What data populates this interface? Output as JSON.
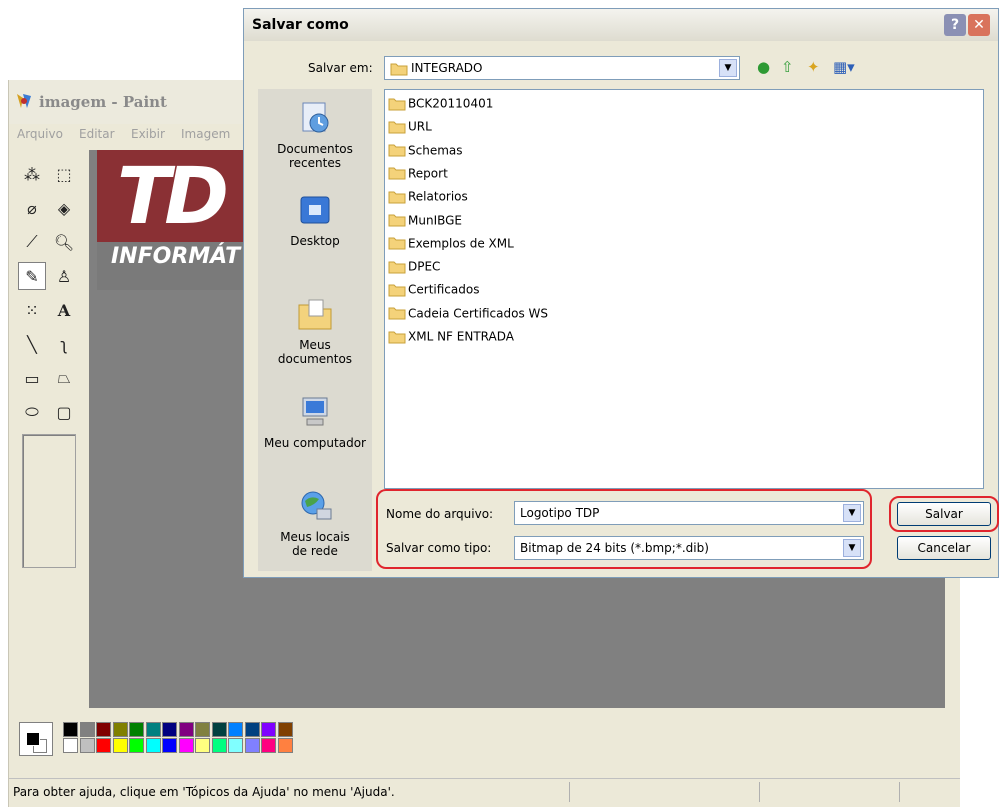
{
  "paint": {
    "title": "imagem - Paint",
    "menu": [
      "Arquivo",
      "Editar",
      "Exibir",
      "Imagem"
    ],
    "status_text": "Para obter ajuda, clique em 'Tópicos da Ajuda' no menu 'Ajuda'.",
    "logo_letters": "TD",
    "logo_sub": "INFORMÁT",
    "palette_top": [
      "#000000",
      "#808080",
      "#800000",
      "#808000",
      "#008000",
      "#008080",
      "#000080",
      "#800080",
      "#808040",
      "#004040",
      "#0080ff",
      "#004080",
      "#8000ff",
      "#804000"
    ],
    "palette_bottom": [
      "#ffffff",
      "#c0c0c0",
      "#ff0000",
      "#ffff00",
      "#00ff00",
      "#00ffff",
      "#0000ff",
      "#ff00ff",
      "#ffff80",
      "#00ff80",
      "#80ffff",
      "#8080ff",
      "#ff0080",
      "#ff8040"
    ]
  },
  "dialog": {
    "title": "Salvar como",
    "help_glyph": "?",
    "close_glyph": "✕",
    "save_in_label": "Salvar em:",
    "save_in_value": "INTEGRADO",
    "places": {
      "recent": "Documentos recentes",
      "desktop": "Desktop",
      "documents": "Meus documentos",
      "computer": "Meu computador",
      "network": "Meus locais de rede"
    },
    "folders": [
      "BCK20110401",
      "URL",
      "Schemas",
      "Report",
      "Relatorios",
      "MunIBGE",
      "Exemplos de XML",
      "DPEC",
      "Certificados",
      "Cadeia Certificados WS",
      "XML NF ENTRADA"
    ],
    "filename_label": "Nome do arquivo:",
    "filename_value": "Logotipo TDP",
    "filetype_label": "Salvar como tipo:",
    "filetype_value": "Bitmap de 24 bits (*.bmp;*.dib)",
    "save_button": "Salvar",
    "cancel_button": "Cancelar",
    "dropdown_glyph": "▼"
  }
}
